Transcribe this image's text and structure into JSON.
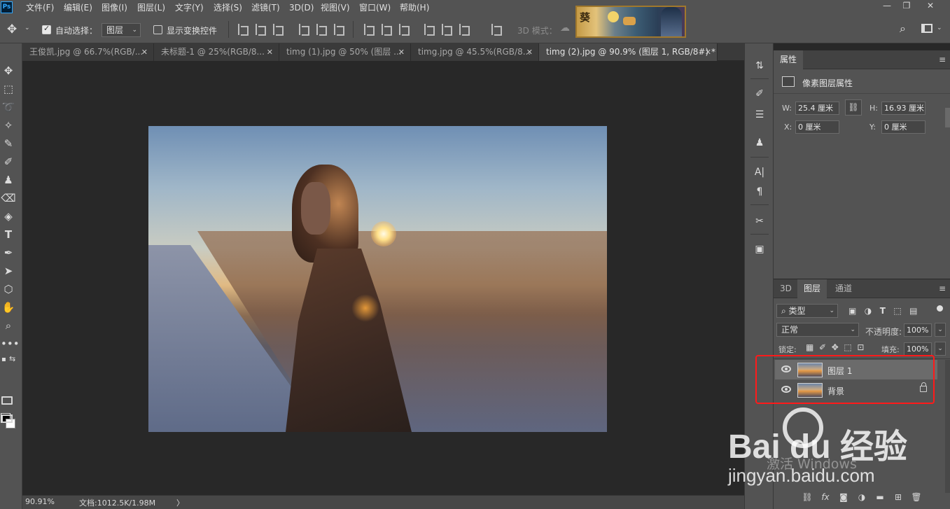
{
  "app": {
    "logo": "Ps",
    "menu": [
      "文件(F)",
      "编辑(E)",
      "图像(I)",
      "图层(L)",
      "文字(Y)",
      "选择(S)",
      "滤镜(T)",
      "3D(D)",
      "视图(V)",
      "窗口(W)",
      "帮助(H)"
    ],
    "window_controls": {
      "minimize": "—",
      "restore": "❐",
      "close": "✕"
    }
  },
  "options_bar": {
    "auto_select_label": "自动选择：",
    "auto_select_checked": true,
    "auto_select_target": "图层",
    "show_transform_label": "显示变换控件",
    "show_transform_checked": false,
    "mode_3d_label": "3D 模式："
  },
  "tabs": [
    {
      "label": "王俊凯.jpg @ 66.7%(RGB/...",
      "close": "✕",
      "active": false
    },
    {
      "label": "未标题-1 @ 25%(RGB/8...",
      "close": "✕",
      "active": false
    },
    {
      "label": "timg (1).jpg @ 50% (图层 ...",
      "close": "✕",
      "active": false
    },
    {
      "label": "timg.jpg @ 45.5%(RGB/8...",
      "close": "✕",
      "active": false
    },
    {
      "label": "timg (2).jpg @ 90.9% (图层 1, RGB/8#) *",
      "close": "✕",
      "active": true
    }
  ],
  "status_bar": {
    "zoom": "90.91%",
    "doc_info": "文档:1012.5K/1.98M",
    "arrow": "〉"
  },
  "properties_panel": {
    "tab_label": "属性",
    "menu_icon": "≡",
    "section_title": "像素图层属性",
    "w_label": "W:",
    "w_value": "25.4 厘米",
    "h_label": "H:",
    "h_value": "16.93 厘米",
    "x_label": "X:",
    "x_value": "0 厘米",
    "y_label": "Y:",
    "y_value": "0 厘米",
    "link_icon": "⛓"
  },
  "layers_panel": {
    "tabs": [
      {
        "label": "3D",
        "active": false
      },
      {
        "label": "图层",
        "active": true
      },
      {
        "label": "通道",
        "active": false
      }
    ],
    "menu_icon": "≡",
    "filter_kind": "类型",
    "blend_mode": "正常",
    "opacity_label": "不透明度:",
    "opacity_value": "100%",
    "lock_label": "锁定:",
    "fill_label": "填充:",
    "fill_value": "100%",
    "layers": [
      {
        "name": "图层 1",
        "visible": true,
        "locked": false,
        "selected": true
      },
      {
        "name": "背景",
        "visible": true,
        "locked": true,
        "selected": false
      }
    ]
  },
  "watermark": {
    "brand": "Bai du 经验",
    "url": "jingyan.baidu.com",
    "activate": "激活 Windows"
  },
  "banner": {
    "char": "葵"
  }
}
